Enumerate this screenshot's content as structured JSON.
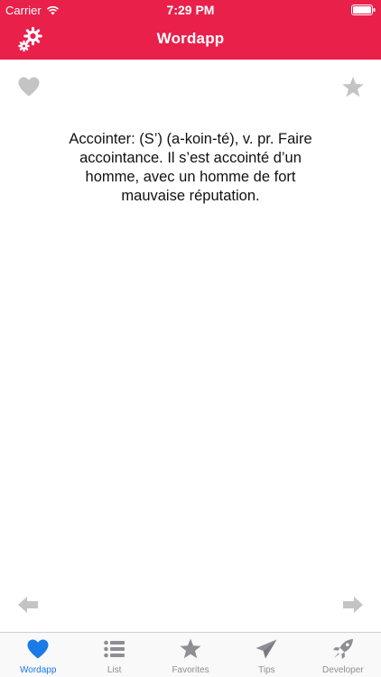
{
  "status_bar": {
    "carrier": "Carrier",
    "time": "7:29 PM"
  },
  "nav": {
    "title": "Wordapp"
  },
  "entry": {
    "definition": "Accointer: (S’) (a-koin-té), v. pr. Faire accointance. Il s’est accointé d’un homme, avec un homme de fort mauvaise réputation."
  },
  "tabs": [
    {
      "label": "Wordapp",
      "icon": "heart-icon",
      "active": true
    },
    {
      "label": "List",
      "icon": "list-icon"
    },
    {
      "label": "Favorites",
      "icon": "star-icon"
    },
    {
      "label": "Tips",
      "icon": "paper-plane-icon"
    },
    {
      "label": "Developer",
      "icon": "rocket-icon"
    }
  ],
  "colors": {
    "accent": "#e8204a",
    "tab_active": "#1a7ae8",
    "tab_inactive": "#8e8e93",
    "icon_gray": "#c4c4c4"
  }
}
